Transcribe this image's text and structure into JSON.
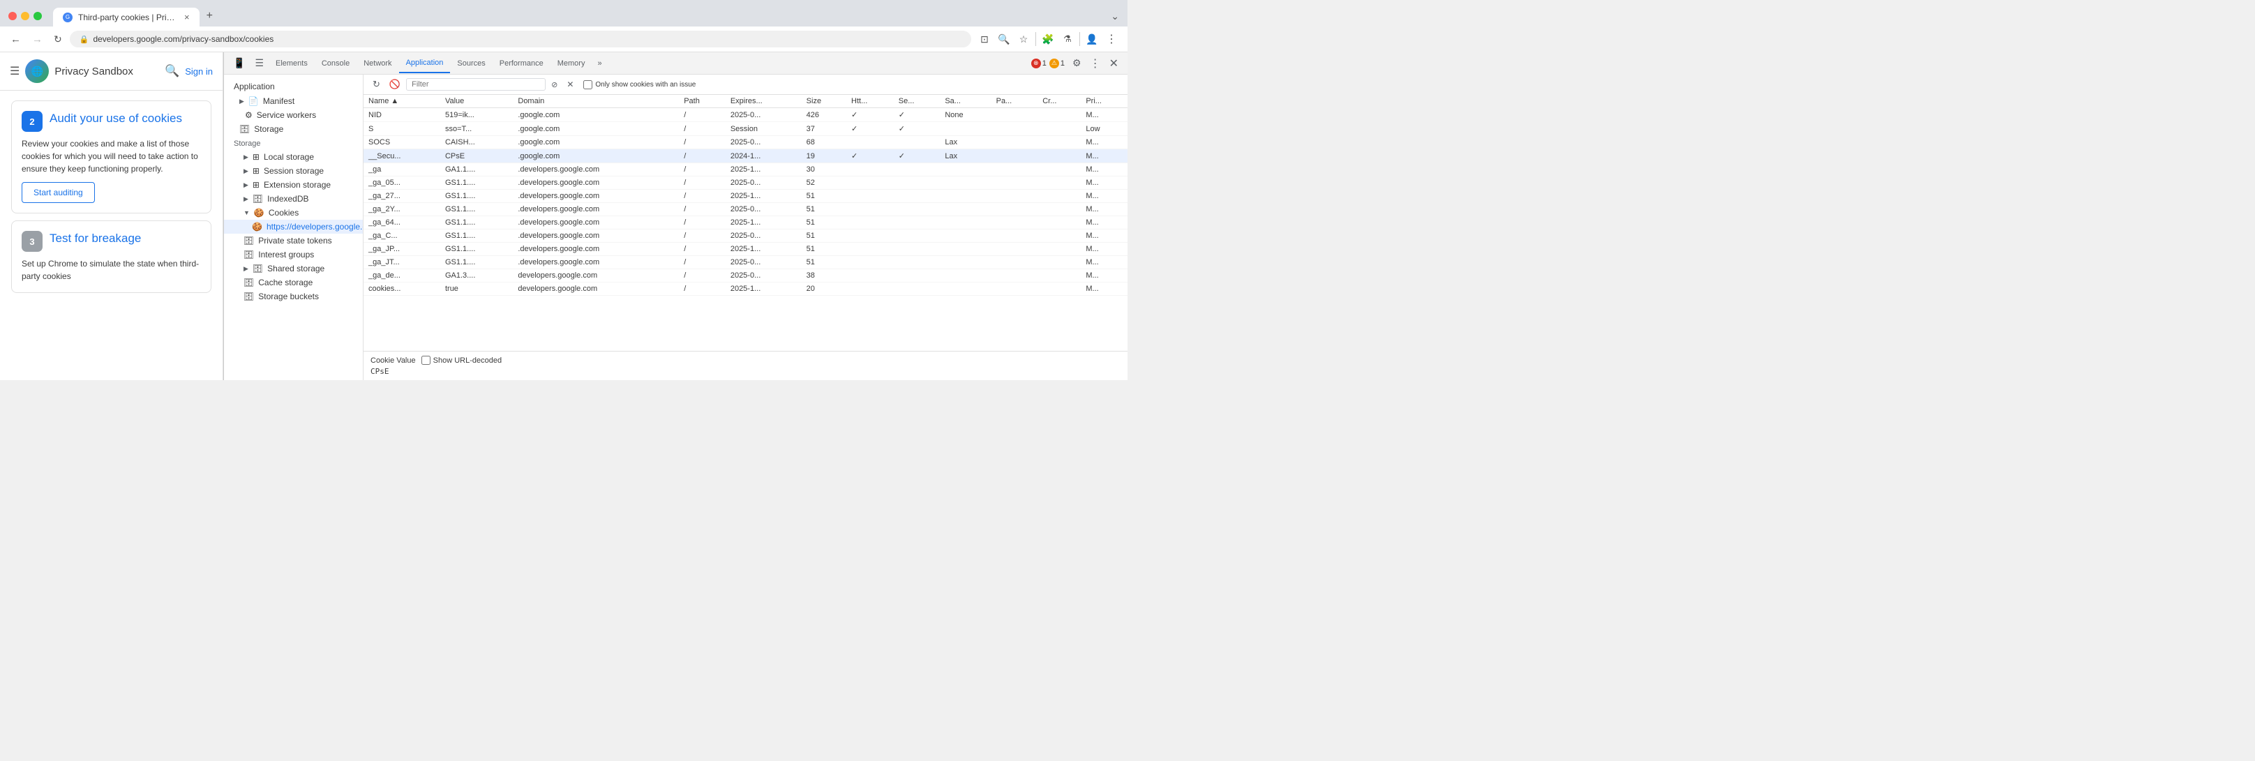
{
  "browser": {
    "tab_title": "Third-party cookies | Privac...",
    "tab_close": "×",
    "tab_new": "+",
    "address": "developers.google.com/privacy-sandbox/cookies",
    "chevron_down": "⌄"
  },
  "site": {
    "title": "Privacy Sandbox",
    "signin": "Sign in"
  },
  "steps": [
    {
      "number": "2",
      "title": "Audit your use of cookies",
      "desc": "Review your cookies and make a list of those cookies for which you will need to take action to ensure they keep functioning properly.",
      "btn": "Start auditing",
      "badge_color": "blue"
    },
    {
      "number": "3",
      "title": "Test for breakage",
      "desc": "Set up Chrome to simulate the state when third-party cookies",
      "badge_color": "gray"
    }
  ],
  "devtools": {
    "tabs": [
      "Elements",
      "Console",
      "Network",
      "Application",
      "Sources",
      "Performance",
      "Memory",
      "»"
    ],
    "active_tab": "Application",
    "error_badge": "1",
    "warn_badge": "1"
  },
  "app_sidebar": {
    "top_label": "Application",
    "manifest_label": "Manifest",
    "service_workers_label": "Service workers",
    "storage_top": "Storage",
    "local_storage": "Local storage",
    "session_storage": "Session storage",
    "extension_storage": "Extension storage",
    "indexeddb": "IndexedDB",
    "cookies": "Cookies",
    "cookies_url": "https://developers.google.com",
    "private_tokens": "Private state tokens",
    "interest_groups": "Interest groups",
    "shared_storage": "Shared storage",
    "cache_storage": "Cache storage",
    "storage_buckets": "Storage buckets"
  },
  "cookie_toolbar": {
    "filter_placeholder": "Filter",
    "only_issues_label": "Only show cookies with an issue"
  },
  "cookie_table": {
    "columns": [
      "Name",
      "▲",
      "Value",
      "Domain",
      "Path",
      "Expires...",
      "Size",
      "Htt...",
      "Se...",
      "Sa...",
      "Pa...",
      "Cr...",
      "Pri..."
    ],
    "rows": [
      {
        "name": "NID",
        "value": "519=ik...",
        "domain": ".google.com",
        "path": "/",
        "expires": "2025-0...",
        "size": "426",
        "htt": "✓",
        "se": "✓",
        "sa": "None",
        "pa": "",
        "cr": "",
        "pri": "M..."
      },
      {
        "name": "S",
        "value": "sso=T...",
        "domain": ".google.com",
        "path": "/",
        "expires": "Session",
        "size": "37",
        "htt": "✓",
        "se": "✓",
        "sa": "",
        "pa": "",
        "cr": "",
        "pri": "Low"
      },
      {
        "name": "SOCS",
        "value": "CAISH...",
        "domain": ".google.com",
        "path": "/",
        "expires": "2025-0...",
        "size": "68",
        "htt": "",
        "se": "",
        "sa": "Lax",
        "pa": "",
        "cr": "",
        "pri": "M..."
      },
      {
        "name": "__Secu...",
        "value": "CPsE",
        "domain": ".google.com",
        "path": "/",
        "expires": "2024-1...",
        "size": "19",
        "htt": "✓",
        "se": "✓",
        "sa": "Lax",
        "pa": "",
        "cr": "",
        "pri": "M...",
        "selected": true
      },
      {
        "name": "_ga",
        "value": "GA1.1....",
        "domain": ".developers.google.com",
        "path": "/",
        "expires": "2025-1...",
        "size": "30",
        "htt": "",
        "se": "",
        "sa": "",
        "pa": "",
        "cr": "",
        "pri": "M..."
      },
      {
        "name": "_ga_05...",
        "value": "GS1.1....",
        "domain": ".developers.google.com",
        "path": "/",
        "expires": "2025-0...",
        "size": "52",
        "htt": "",
        "se": "",
        "sa": "",
        "pa": "",
        "cr": "",
        "pri": "M..."
      },
      {
        "name": "_ga_27...",
        "value": "GS1.1....",
        "domain": ".developers.google.com",
        "path": "/",
        "expires": "2025-1...",
        "size": "51",
        "htt": "",
        "se": "",
        "sa": "",
        "pa": "",
        "cr": "",
        "pri": "M..."
      },
      {
        "name": "_ga_2Y...",
        "value": "GS1.1....",
        "domain": ".developers.google.com",
        "path": "/",
        "expires": "2025-0...",
        "size": "51",
        "htt": "",
        "se": "",
        "sa": "",
        "pa": "",
        "cr": "",
        "pri": "M..."
      },
      {
        "name": "_ga_64...",
        "value": "GS1.1....",
        "domain": ".developers.google.com",
        "path": "/",
        "expires": "2025-1...",
        "size": "51",
        "htt": "",
        "se": "",
        "sa": "",
        "pa": "",
        "cr": "",
        "pri": "M..."
      },
      {
        "name": "_ga_C...",
        "value": "GS1.1....",
        "domain": ".developers.google.com",
        "path": "/",
        "expires": "2025-0...",
        "size": "51",
        "htt": "",
        "se": "",
        "sa": "",
        "pa": "",
        "cr": "",
        "pri": "M..."
      },
      {
        "name": "_ga_JP...",
        "value": "GS1.1....",
        "domain": ".developers.google.com",
        "path": "/",
        "expires": "2025-1...",
        "size": "51",
        "htt": "",
        "se": "",
        "sa": "",
        "pa": "",
        "cr": "",
        "pri": "M..."
      },
      {
        "name": "_ga_JT...",
        "value": "GS1.1....",
        "domain": ".developers.google.com",
        "path": "/",
        "expires": "2025-0...",
        "size": "51",
        "htt": "",
        "se": "",
        "sa": "",
        "pa": "",
        "cr": "",
        "pri": "M..."
      },
      {
        "name": "_ga_de...",
        "value": "GA1.3....",
        "domain": "developers.google.com",
        "path": "/",
        "expires": "2025-0...",
        "size": "38",
        "htt": "",
        "se": "",
        "sa": "",
        "pa": "",
        "cr": "",
        "pri": "M..."
      },
      {
        "name": "cookies...",
        "value": "true",
        "domain": "developers.google.com",
        "path": "/",
        "expires": "2025-1...",
        "size": "20",
        "htt": "",
        "se": "",
        "sa": "",
        "pa": "",
        "cr": "",
        "pri": "M..."
      }
    ],
    "selected_row_name": "__Secu...",
    "cookie_value_label": "Cookie Value",
    "show_url_decoded": "Show URL-decoded",
    "cookie_value": "CPsE"
  }
}
